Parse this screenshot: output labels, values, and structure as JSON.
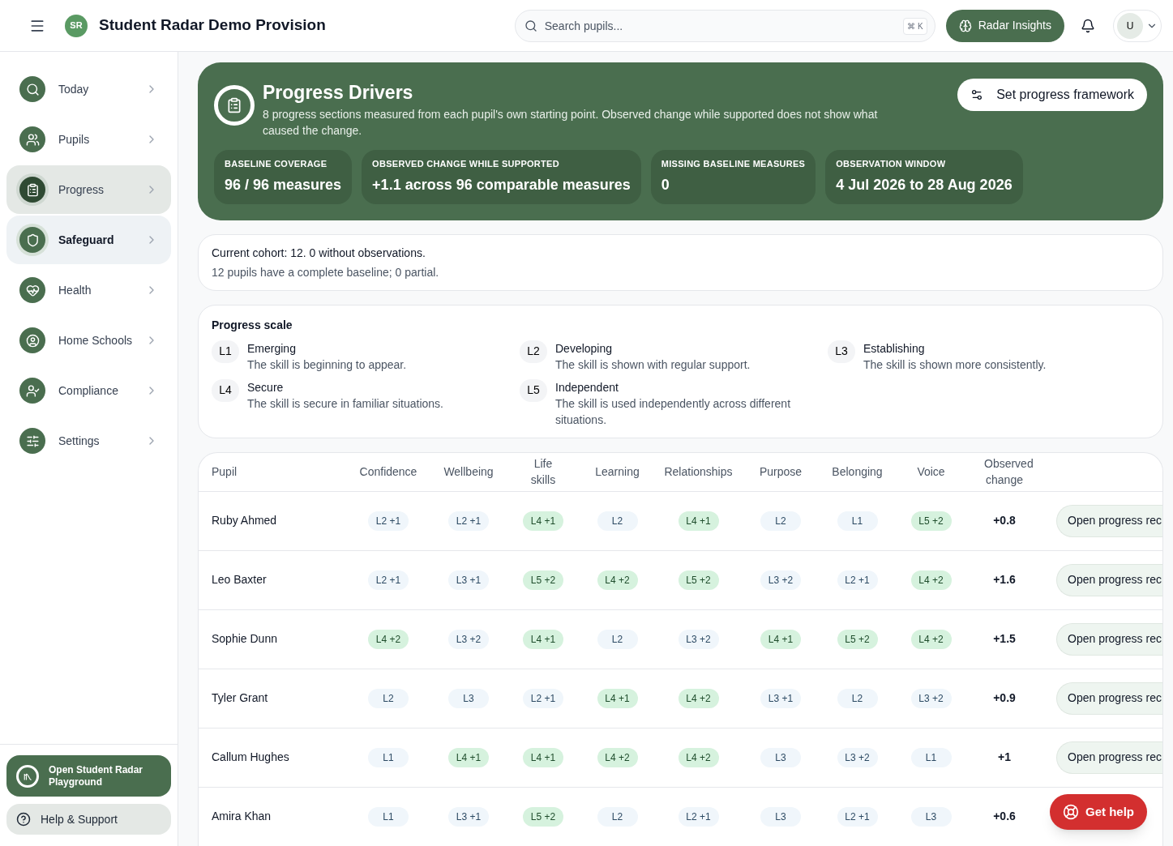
{
  "header": {
    "logo_text": "SR",
    "title": "Student Radar Demo Provision",
    "search": {
      "placeholder": "Search pupils...",
      "shortcut": "⌘ K"
    },
    "insights_button": "Radar Insights",
    "avatar": "U"
  },
  "sidebar": {
    "items": [
      {
        "label": "Today",
        "selected": false,
        "hovered": false
      },
      {
        "label": "Pupils",
        "selected": false,
        "hovered": false
      },
      {
        "label": "Progress",
        "selected": true,
        "hovered": false
      },
      {
        "label": "Safeguard",
        "selected": false,
        "hovered": true
      },
      {
        "label": "Health",
        "selected": false,
        "hovered": false
      },
      {
        "label": "Home Schools",
        "selected": false,
        "hovered": false
      },
      {
        "label": "Compliance",
        "selected": false,
        "hovered": false
      },
      {
        "label": "Settings",
        "selected": false,
        "hovered": false
      }
    ],
    "playground_button": "Open Student Radar Playground",
    "help_button": "Help & Support"
  },
  "hero": {
    "title": "Progress Drivers",
    "description": "8 progress sections measured from each pupil's own starting point. Observed change while supported does not show what caused the change.",
    "action": "Set progress framework",
    "stats": [
      {
        "label": "BASELINE COVERAGE",
        "value": "96 / 96 measures"
      },
      {
        "label": "OBSERVED CHANGE WHILE SUPPORTED",
        "value": "+1.1 across 96 comparable measures"
      },
      {
        "label": "MISSING BASELINE MEASURES",
        "value": "0"
      },
      {
        "label": "OBSERVATION WINDOW",
        "value": "4 Jul 2026 to 28 Aug 2026"
      }
    ]
  },
  "cohort": {
    "line_1": "Current cohort: 12. 0 without observations.",
    "line_2": "12 pupils have a complete baseline; 0 partial."
  },
  "scale": {
    "title": "Progress scale",
    "levels": [
      {
        "code": "L1",
        "name": "Emerging",
        "description": "The skill is beginning to appear."
      },
      {
        "code": "L2",
        "name": "Developing",
        "description": "The skill is shown with regular support."
      },
      {
        "code": "L3",
        "name": "Establishing",
        "description": "The skill is shown more consistently."
      },
      {
        "code": "L4",
        "name": "Secure",
        "description": "The skill is secure in familiar situations."
      },
      {
        "code": "L5",
        "name": "Independent",
        "description": "The skill is used independently across different situations."
      }
    ]
  },
  "table": {
    "columns": [
      "Pupil",
      "Confidence",
      "Wellbeing",
      "Life skills",
      "Learning",
      "Relationships",
      "Purpose",
      "Belonging",
      "Voice",
      "Observed change"
    ],
    "rows": [
      {
        "cells": [
          {
            "kind": "name",
            "text": "Ruby Ahmed"
          },
          {
            "kind": "level",
            "text": "L2 +1",
            "highlighted": false
          },
          {
            "kind": "level",
            "text": "L2 +1",
            "highlighted": false
          },
          {
            "kind": "level",
            "text": "L4 +1",
            "highlighted": true
          },
          {
            "kind": "level",
            "text": "L2",
            "highlighted": false
          },
          {
            "kind": "level",
            "text": "L4 +1",
            "highlighted": true
          },
          {
            "kind": "level",
            "text": "L2",
            "highlighted": false
          },
          {
            "kind": "level",
            "text": "L1",
            "highlighted": false
          },
          {
            "kind": "level",
            "text": "L5 +2",
            "highlighted": true
          },
          {
            "kind": "change",
            "text": "+0.8"
          },
          {
            "kind": "action",
            "text": "Open progress rec"
          }
        ]
      },
      {
        "cells": [
          {
            "kind": "name",
            "text": "Leo Baxter"
          },
          {
            "kind": "level",
            "text": "L2 +1",
            "highlighted": false
          },
          {
            "kind": "level",
            "text": "L3 +1",
            "highlighted": false
          },
          {
            "kind": "level",
            "text": "L5 +2",
            "highlighted": true
          },
          {
            "kind": "level",
            "text": "L4 +2",
            "highlighted": true
          },
          {
            "kind": "level",
            "text": "L5 +2",
            "highlighted": true
          },
          {
            "kind": "level",
            "text": "L3 +2",
            "highlighted": false
          },
          {
            "kind": "level",
            "text": "L2 +1",
            "highlighted": false
          },
          {
            "kind": "level",
            "text": "L4 +2",
            "highlighted": true
          },
          {
            "kind": "change",
            "text": "+1.6"
          },
          {
            "kind": "action",
            "text": "Open progress rec"
          }
        ]
      },
      {
        "cells": [
          {
            "kind": "name",
            "text": "Sophie Dunn"
          },
          {
            "kind": "level",
            "text": "L4 +2",
            "highlighted": true
          },
          {
            "kind": "level",
            "text": "L3 +2",
            "highlighted": false
          },
          {
            "kind": "level",
            "text": "L4 +1",
            "highlighted": true
          },
          {
            "kind": "level",
            "text": "L2",
            "highlighted": false
          },
          {
            "kind": "level",
            "text": "L3 +2",
            "highlighted": false
          },
          {
            "kind": "level",
            "text": "L4 +1",
            "highlighted": true
          },
          {
            "kind": "level",
            "text": "L5 +2",
            "highlighted": true
          },
          {
            "kind": "level",
            "text": "L4 +2",
            "highlighted": true
          },
          {
            "kind": "change",
            "text": "+1.5"
          },
          {
            "kind": "action",
            "text": "Open progress rec"
          }
        ]
      },
      {
        "cells": [
          {
            "kind": "name",
            "text": "Tyler Grant"
          },
          {
            "kind": "level",
            "text": "L2",
            "highlighted": false
          },
          {
            "kind": "level",
            "text": "L3",
            "highlighted": false
          },
          {
            "kind": "level",
            "text": "L2 +1",
            "highlighted": false
          },
          {
            "kind": "level",
            "text": "L4 +1",
            "highlighted": true
          },
          {
            "kind": "level",
            "text": "L4 +2",
            "highlighted": true
          },
          {
            "kind": "level",
            "text": "L3 +1",
            "highlighted": false
          },
          {
            "kind": "level",
            "text": "L2",
            "highlighted": false
          },
          {
            "kind": "level",
            "text": "L3 +2",
            "highlighted": false
          },
          {
            "kind": "change",
            "text": "+0.9"
          },
          {
            "kind": "action",
            "text": "Open progress rec"
          }
        ]
      },
      {
        "cells": [
          {
            "kind": "name",
            "text": "Callum Hughes"
          },
          {
            "kind": "level",
            "text": "L1",
            "highlighted": false
          },
          {
            "kind": "level",
            "text": "L4 +1",
            "highlighted": true
          },
          {
            "kind": "level",
            "text": "L4 +1",
            "highlighted": true
          },
          {
            "kind": "level",
            "text": "L4 +2",
            "highlighted": true
          },
          {
            "kind": "level",
            "text": "L4 +2",
            "highlighted": true
          },
          {
            "kind": "level",
            "text": "L3",
            "highlighted": false
          },
          {
            "kind": "level",
            "text": "L3 +2",
            "highlighted": false
          },
          {
            "kind": "level",
            "text": "L1",
            "highlighted": false
          },
          {
            "kind": "change",
            "text": "+1"
          },
          {
            "kind": "action",
            "text": "Open progress rec"
          }
        ]
      },
      {
        "cells": [
          {
            "kind": "name",
            "text": "Amira Khan"
          },
          {
            "kind": "level",
            "text": "L1",
            "highlighted": false
          },
          {
            "kind": "level",
            "text": "L3 +1",
            "highlighted": false
          },
          {
            "kind": "level",
            "text": "L5 +2",
            "highlighted": true
          },
          {
            "kind": "level",
            "text": "L2",
            "highlighted": false
          },
          {
            "kind": "level",
            "text": "L2 +1",
            "highlighted": false
          },
          {
            "kind": "level",
            "text": "L3",
            "highlighted": false
          },
          {
            "kind": "level",
            "text": "L2 +1",
            "highlighted": false
          },
          {
            "kind": "level",
            "text": "L3",
            "highlighted": false
          },
          {
            "kind": "change",
            "text": "+0.6"
          }
        ]
      }
    ]
  },
  "help_fab": "Get help"
}
